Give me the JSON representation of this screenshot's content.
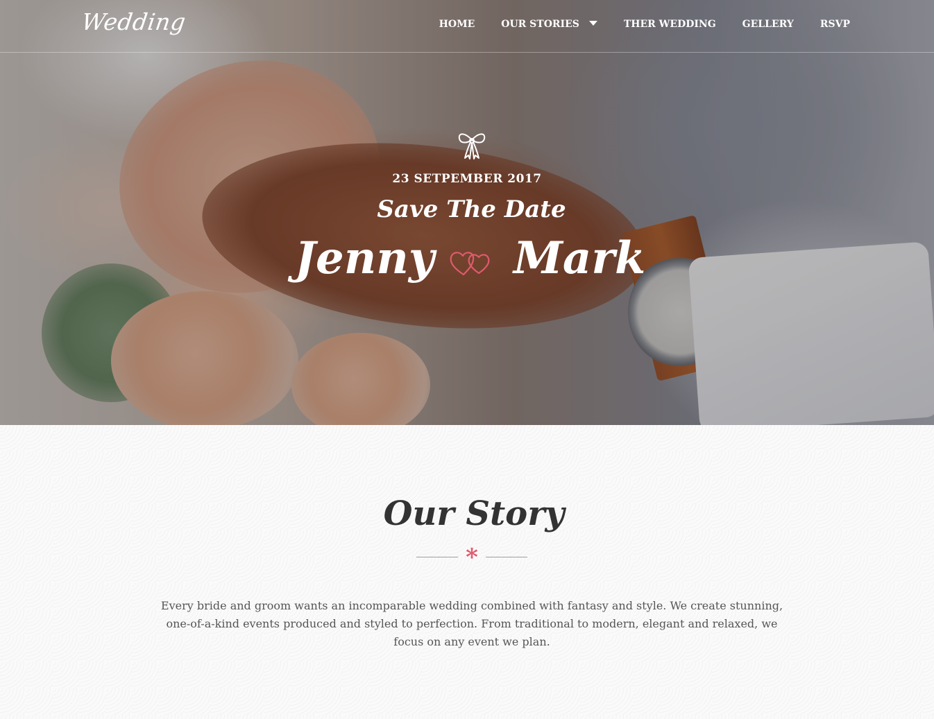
{
  "header": {
    "logo": "Wedding",
    "nav": [
      {
        "label": "HOME"
      },
      {
        "label": "OUR STORIES",
        "has_dropdown": true
      },
      {
        "label": "THER WEDDING"
      },
      {
        "label": "GELLERY"
      },
      {
        "label": "RSVP"
      }
    ]
  },
  "hero": {
    "date": "23 SETPEMBER 2017",
    "tagline": "Save The Date",
    "bride": "Jenny",
    "groom": "Mark",
    "icons": [
      "bow-icon",
      "hearts-icon"
    ]
  },
  "story": {
    "title": "Our Story",
    "text": "Every bride and groom wants an incomparable wedding combined with fantasy and style. We create stunning, one-of-a-kind events produced and styled to perfection. From traditional to modern, elegant and relaxed, we focus on any event we plan."
  },
  "colors": {
    "accent": "#e05a6e",
    "text_dark": "#333333",
    "text_body": "#555555",
    "nav_text": "#ffffff"
  }
}
